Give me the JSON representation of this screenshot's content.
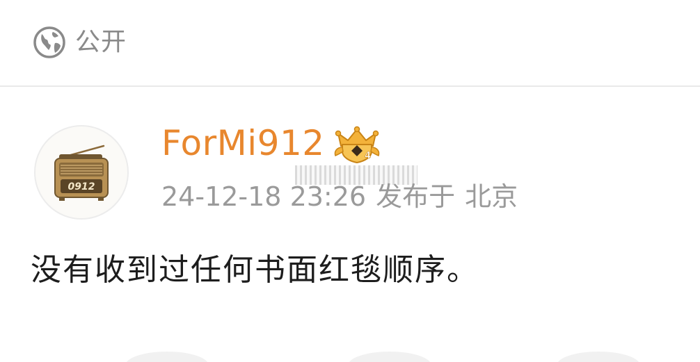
{
  "visibility": {
    "icon": "globe-icon",
    "label": "公开"
  },
  "post": {
    "author": {
      "name": "ForMi912",
      "avatar_text": "0912",
      "badge_icon": "crown-badge-icon",
      "badge_level": "4"
    },
    "meta": {
      "time": "24-12-18 23:26",
      "published_prefix": "发布于",
      "location": "北京"
    },
    "text": "没有收到过任何书面红毯顺序。"
  },
  "colors": {
    "username": "#e8872e",
    "meta": "#9a9a9a",
    "body_text": "#1d1d1d",
    "divider": "#e9e9e9"
  }
}
